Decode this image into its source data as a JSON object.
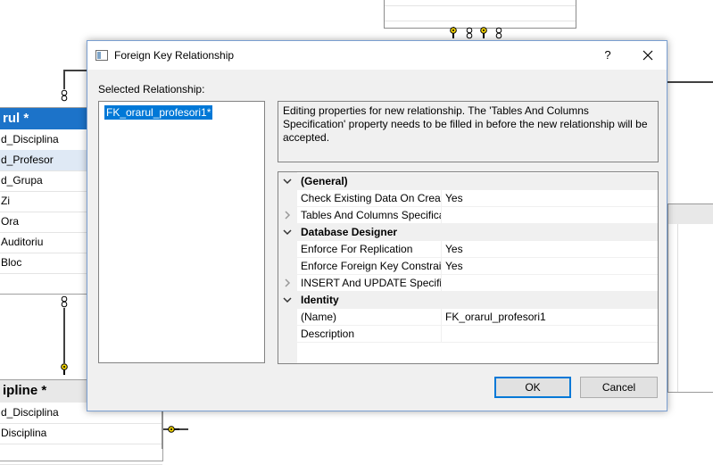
{
  "dialog": {
    "title": "Foreign Key Relationship",
    "help_label": "?",
    "selected_relationship_label": "Selected Relationship:",
    "relationships": [
      "FK_orarul_profesori1*"
    ],
    "info_text": "Editing properties for new relationship.  The 'Tables And Columns Specification' property needs to be filled in before the new relationship will be accepted.",
    "properties": [
      {
        "type": "category",
        "name": "(General)",
        "expanded": true
      },
      {
        "type": "prop",
        "name": "Check Existing Data On Creati",
        "value": "Yes"
      },
      {
        "type": "prop",
        "name": "Tables And Columns Specifica",
        "value": "",
        "expandable": true
      },
      {
        "type": "category",
        "name": "Database Designer",
        "expanded": true
      },
      {
        "type": "prop",
        "name": "Enforce For Replication",
        "value": "Yes"
      },
      {
        "type": "prop",
        "name": "Enforce Foreign Key Constrair",
        "value": "Yes"
      },
      {
        "type": "prop",
        "name": "INSERT And UPDATE Specifica",
        "value": "",
        "expandable": true
      },
      {
        "type": "category",
        "name": "Identity",
        "expanded": true
      },
      {
        "type": "prop",
        "name": "(Name)",
        "value": "FK_orarul_profesori1"
      },
      {
        "type": "prop",
        "name": "Description",
        "value": ""
      }
    ],
    "ok_label": "OK",
    "cancel_label": "Cancel"
  },
  "diagram": {
    "orarul": {
      "title": "rul *",
      "rows": [
        "d_Disciplina",
        "d_Profesor",
        "d_Grupa",
        "Zi",
        "Ora",
        "Auditoriu",
        "Bloc"
      ],
      "selected_row": 1
    },
    "discipline": {
      "title": "ipline *",
      "rows": [
        "d_Disciplina",
        "Disciplina"
      ]
    }
  },
  "colors": {
    "accent": "#0078d7",
    "table_header": "#1c73c9",
    "dialog_bg": "#f0f0f0",
    "key_icon": "#f2d300"
  }
}
